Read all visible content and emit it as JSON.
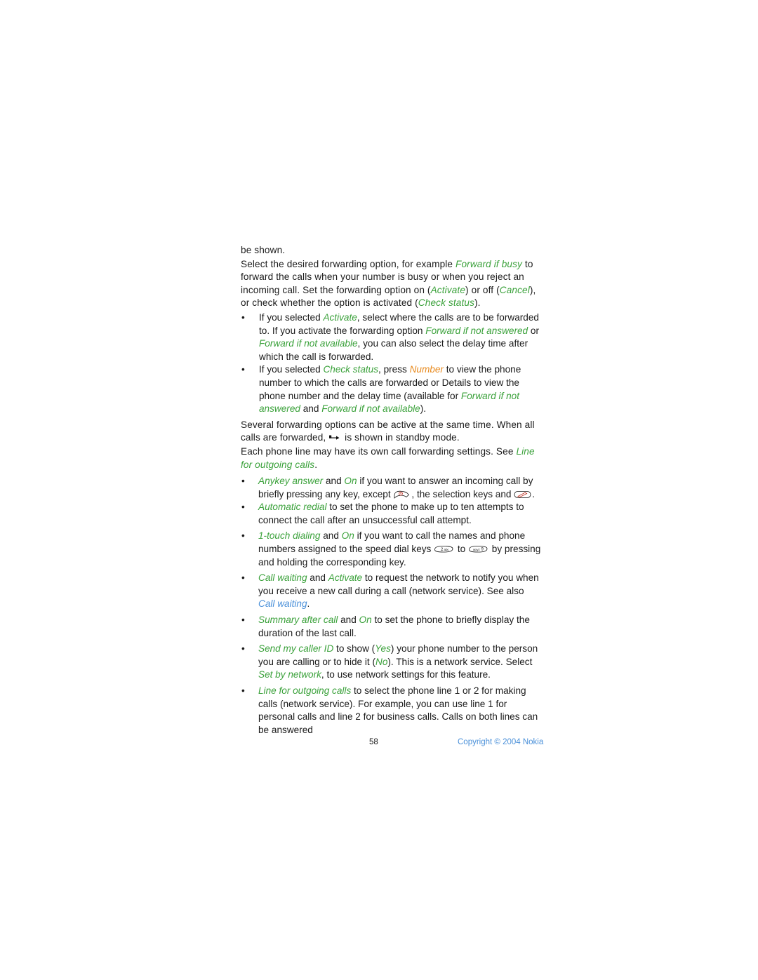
{
  "document": {
    "paragraphs": {
      "p_be_shown": "be shown.",
      "p_select_1": "Select the desired forwarding option, for example ",
      "p_select_em1": "Forward if busy",
      "p_select_2": " to forward the calls when your number is busy or when you reject an incoming call. Set the forwarding option on (",
      "p_select_em2": "Activate",
      "p_select_3": ") or off (",
      "p_select_em3": "Cancel",
      "p_select_4": "), or check whether the option is activated (",
      "p_select_em4": "Check status",
      "p_select_5": ").",
      "b1_1": "If you selected ",
      "b1_em1": "Activate",
      "b1_2": ", select where the calls are to be forwarded to. If you activate the forwarding option ",
      "b1_em2": "Forward if not answered",
      "b1_3": " or ",
      "b1_em3": "Forward if not available",
      "b1_4": ", you can also select the delay time after which the call is forwarded.",
      "b2_1": "If you selected ",
      "b2_em1": "Check status",
      "b2_2": ", press ",
      "b2_em2": "Number",
      "b2_3": " to view the phone number to which the calls are forwarded or Details to view the phone number and the delay time (available for ",
      "b2_em3": "Forward if not answered",
      "b2_4": " and ",
      "b2_em4": "Forward if not available",
      "b2_5": ").",
      "p_several_1": "Several forwarding options can be active at the same time. When all calls are forwarded, ",
      "p_several_2": " is shown in standby mode.",
      "p_eachline_1": "Each phone line may have its own call forwarding settings. See ",
      "p_eachline_em1": "Line for outgoing calls",
      "p_eachline_2": ".",
      "b3_em1": "Anykey answer",
      "b3_1": " and ",
      "b3_em2": "On",
      "b3_2": " if you want to answer an incoming call by briefly pressing any key, except ",
      "b3_3": ", the selection keys and ",
      "b3_4": ".",
      "b4_em1": "Automatic redial",
      "b4_1": " to set the phone to make up to ten attempts to connect the call after an unsuccessful call attempt.",
      "b5_em1": "1-touch dialing",
      "b5_1": " and ",
      "b5_em2": "On",
      "b5_2": " if you want to call the names and phone numbers assigned to the speed dial keys ",
      "b5_3": " to ",
      "b5_4": " by pressing and holding the corresponding key.",
      "b6_em1": "Call waiting",
      "b6_1": " and ",
      "b6_em2": "Activate",
      "b6_2": " to request the network to notify you when you receive a new call during a call (network service). See also ",
      "b6_link": "Call waiting",
      "b6_3": ".",
      "b7_em1": "Summary after call",
      "b7_1": " and ",
      "b7_em2": "On",
      "b7_2": " to set the phone to briefly display the duration of the last call.",
      "b8_em1": "Send my caller ID",
      "b8_1": " to show (",
      "b8_em2": "Yes",
      "b8_2": ") your phone number to the person you are calling or to hide it (",
      "b8_em3": "No",
      "b8_3": "). This is a network service. Select ",
      "b8_em4": "Set by network",
      "b8_4": ", to use network settings for this feature.",
      "b9_em1": "Line for outgoing calls",
      "b9_1": " to select the phone line 1 or 2 for making calls (network service). For example, you can use line 1 for personal calls and line 2 for business calls. Calls on both lines can be answered"
    },
    "bullet_mark": "•",
    "icons": {
      "call_forward": "call-forward-icon",
      "end_call_key": "end-call-key-icon",
      "edit_pen_key": "edit-pen-key-icon",
      "key_2abc": "key-2abc-icon",
      "key_9wxyz": "key-9wxyz-icon"
    },
    "footer": {
      "page_number": "58",
      "copyright": "Copyright © 2004 Nokia"
    },
    "colors": {
      "accent_green": "#3aa13a",
      "accent_orange": "#e88b20",
      "accent_blue": "#4a90d9",
      "text": "#1a1a1a"
    }
  }
}
